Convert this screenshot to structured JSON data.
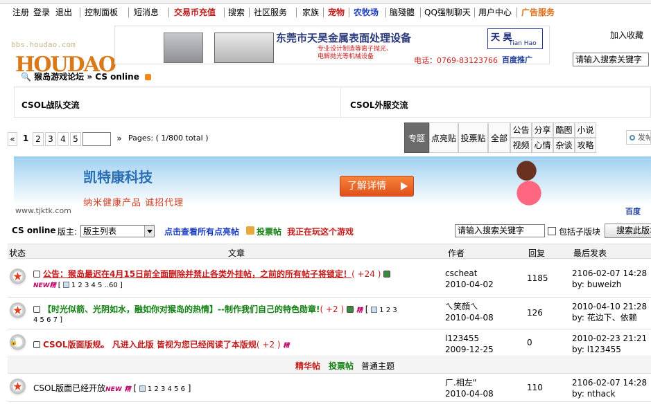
{
  "top_nav": [
    {
      "label": "注册",
      "color": "#000000"
    },
    {
      "label": "登录",
      "color": "#000000"
    },
    {
      "label": "退出",
      "color": "#000000"
    },
    {
      "label": "控制面板",
      "color": "#000000"
    },
    {
      "label": "短消息",
      "color": "#000000"
    },
    {
      "label": "交易币充值",
      "color": "#c41a1a"
    },
    {
      "label": "搜索",
      "color": "#000000"
    },
    {
      "label": "社区服务",
      "color": "#000000"
    },
    {
      "label": "家族",
      "color": "#000000"
    },
    {
      "label": "宠物",
      "color": "#c41a1a"
    },
    {
      "label": "农牧场",
      "color": "#1a3cc0"
    },
    {
      "label": "脑殘體",
      "color": "#000000"
    },
    {
      "label": "QQ强制聊天",
      "color": "#000000"
    },
    {
      "label": "用户中心",
      "color": "#000000"
    },
    {
      "label": "广告服务",
      "color": "#e0701a"
    }
  ],
  "logo": {
    "watermark": "bbs.houdao.com",
    "mark": "HOUDAO"
  },
  "top_ad": {
    "title": "东莞市天昊金属表面处理设备",
    "desc1": "专业设计制造等离子抛光、",
    "desc2": "电解抛光等机械设备",
    "phone": "电话：0769-83123766",
    "brand_cn": "天 昊",
    "brand_en": "Tian Hao",
    "baidu": "百度推广"
  },
  "header": {
    "favorite": "加入收藏",
    "search_placeholder": "请输入搜索关键字"
  },
  "breadcrumb": {
    "forum": "猴岛游戏论坛",
    "board": "CS online"
  },
  "subboards": [
    "CSOL战队交流",
    "CSOL外服交流"
  ],
  "pager": {
    "first": "«",
    "current": "1",
    "pages": [
      "2",
      "3",
      "4",
      "5"
    ],
    "last": "»",
    "info": "Pages: ( 1/800 total )"
  },
  "filters": {
    "active": "专题",
    "items": [
      "点亮贴",
      "投票贴",
      "全部"
    ],
    "grid": [
      [
        "公告",
        "分享",
        "酷图",
        "小说"
      ],
      [
        "视频",
        "心情",
        "杂谈",
        "攻略"
      ]
    ]
  },
  "post_button": "发帖",
  "banner": {
    "company": "凯特康科技",
    "slogan": "纳米健康产品 诚招代理",
    "url": "www.tjktk.com",
    "cta": "了解详情",
    "baidu": "百度"
  },
  "forum_bar": {
    "name": "CS online",
    "moderator_label": "版主:",
    "moderator_value": "版主列表",
    "link_all": "点击查看所有点亮帖",
    "link_vote": "投票帖",
    "link_playing": "我正在玩这个游戏",
    "search_placeholder": "请输入搜索关键字",
    "include_sub": "包括子版块",
    "search_button": "搜索此版块"
  },
  "table_headers": {
    "status": "状态",
    "topic": "文章",
    "author": "作者",
    "replies": "回复",
    "last": "最后发表"
  },
  "pinned_threads": [
    {
      "title": "公告：猴岛最迟在4月15日前全面删除并禁止各类外挂帖，之前的所有帖子将锁定！",
      "score": "( +24 )",
      "title_color": "#c41a1a",
      "pages": "1 2 3 4 5 ..60",
      "author": "cscheat",
      "date": "2010-04-02",
      "replies": "1185",
      "last_time": "2106-02-07 14:28",
      "last_by": "by: buweizh"
    },
    {
      "title": "【时光似箭、光阴如水，融如你对猴岛的热情】--制作我们自己的特色勋章!",
      "score": "( +2 )",
      "title_color": "#108010",
      "pages": "1 2 3",
      "pages2": "4 5 6 7 ]",
      "author": "ㄟ笑顔ㄟ",
      "date": "2010-04-08",
      "replies": "126",
      "last_time": "2010-04-10 21:28",
      "last_by": "by: 花边下、依赖"
    },
    {
      "title": "CSOL版面版规。 凡进入此版 皆视为您已经阅读了本版规",
      "score": "( +2 )",
      "title_color": "#c41a1a",
      "author": "l123455",
      "date": "2009-12-25",
      "replies": "0",
      "last_time": "2010-02-23 21:21",
      "last_by": "by: l123455"
    }
  ],
  "divider": {
    "digest": "精华帖",
    "vote": "投票帖",
    "normal": "普通主题"
  },
  "threads": [
    {
      "title": "CSOL版面已经开放",
      "pages": "1 2 3 4 5 6",
      "author": "ㄏ.相左\"",
      "date": "2010-04-08",
      "replies": "110",
      "last_time": "2106-02-07 14:28",
      "last_by": "by: nthack"
    }
  ],
  "colors": {
    "red": "#c41a1a",
    "green": "#108010",
    "blue": "#1a3cc0"
  }
}
